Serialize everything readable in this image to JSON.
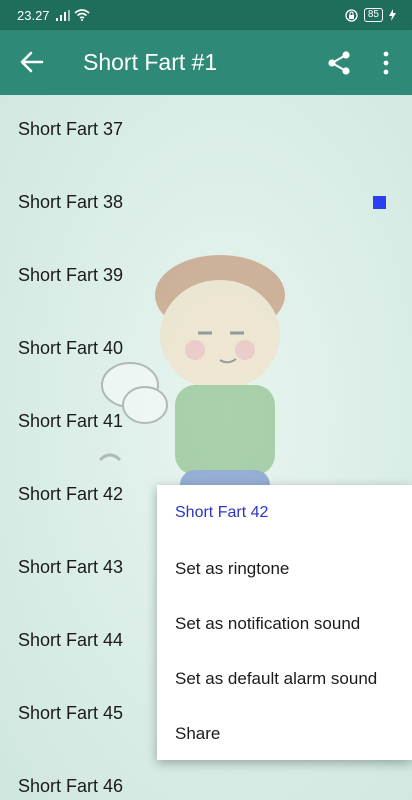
{
  "status_bar": {
    "time": "23.27",
    "battery": "85"
  },
  "app_bar": {
    "title": "Short Fart #1",
    "icons": [
      "back-arrow-icon",
      "share-icon",
      "more-vert-icon"
    ]
  },
  "list": {
    "items": [
      {
        "label": "Short Fart 37"
      },
      {
        "label": "Short Fart 38",
        "playing": true
      },
      {
        "label": "Short Fart 39"
      },
      {
        "label": "Short Fart 40"
      },
      {
        "label": "Short Fart 41"
      },
      {
        "label": "Short Fart 42"
      },
      {
        "label": "Short Fart 43"
      },
      {
        "label": "Short Fart 44"
      },
      {
        "label": "Short Fart 45"
      },
      {
        "label": "Short Fart 46"
      }
    ]
  },
  "context_menu": {
    "title": "Short Fart 42",
    "items": [
      {
        "label": "Set as ringtone"
      },
      {
        "label": "Set as notification sound"
      },
      {
        "label": "Set as default alarm sound"
      },
      {
        "label": "Share"
      }
    ]
  },
  "colors": {
    "status_bar": "#1f6e5c",
    "app_bar": "#2e8a76",
    "menu_title": "#2b35c7",
    "indicator": "#2a3ff0"
  }
}
